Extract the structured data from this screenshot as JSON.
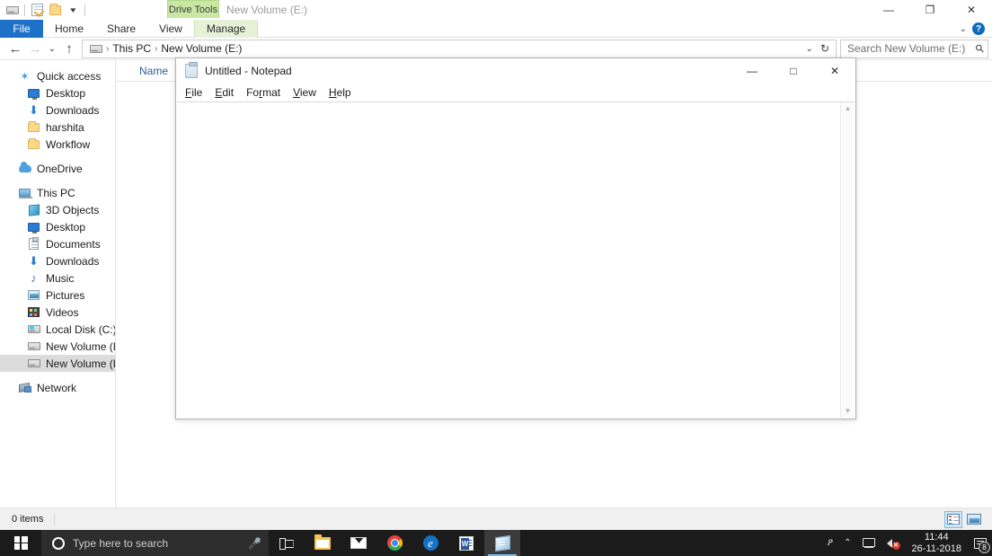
{
  "explorer": {
    "quick_access_toolbar": {
      "drive_icon": "drive-icon",
      "properties_icon": "properties-icon",
      "new_folder_icon": "new-folder-icon",
      "customize_caret": "▾"
    },
    "title": "New Volume (E:)",
    "contextual_tab_group": "Drive Tools",
    "window_buttons": {
      "minimize": "—",
      "restore": "❐",
      "close": "✕"
    },
    "ribbon": {
      "tabs": [
        {
          "label": "File",
          "type": "file"
        },
        {
          "label": "Home",
          "type": "normal"
        },
        {
          "label": "Share",
          "type": "normal"
        },
        {
          "label": "View",
          "type": "normal"
        },
        {
          "label": "Manage",
          "type": "contextual"
        }
      ],
      "collapse_caret": "⌄",
      "help_label": "?"
    },
    "address_bar": {
      "back": "←",
      "forward": "→",
      "recent": "⌄",
      "up": "↑",
      "crumbs": [
        "This PC",
        "New Volume (E:)"
      ],
      "crumb_separator": "›",
      "history_caret": "⌄",
      "refresh": "↻"
    },
    "search": {
      "placeholder": "Search New Volume (E:)",
      "icon": "search-icon"
    },
    "nav_pane": {
      "groups": [
        {
          "header": {
            "label": "Quick access",
            "icon": "pin-star-icon"
          },
          "items": [
            {
              "label": "Desktop",
              "icon": "desktop-icon"
            },
            {
              "label": "Downloads",
              "icon": "download-icon"
            },
            {
              "label": "harshita",
              "icon": "folder-icon"
            },
            {
              "label": "Workflow",
              "icon": "folder-icon"
            }
          ]
        },
        {
          "header": {
            "label": "OneDrive",
            "icon": "cloud-icon"
          },
          "items": []
        },
        {
          "header": {
            "label": "This PC",
            "icon": "this-pc-icon"
          },
          "items": [
            {
              "label": "3D Objects",
              "icon": "3d-objects-icon"
            },
            {
              "label": "Desktop",
              "icon": "desktop-icon"
            },
            {
              "label": "Documents",
              "icon": "documents-icon"
            },
            {
              "label": "Downloads",
              "icon": "download-icon"
            },
            {
              "label": "Music",
              "icon": "music-icon"
            },
            {
              "label": "Pictures",
              "icon": "pictures-icon"
            },
            {
              "label": "Videos",
              "icon": "videos-icon"
            },
            {
              "label": "Local Disk (C:)",
              "icon": "windows-drive-icon"
            },
            {
              "label": "New Volume (D:)",
              "icon": "drive-icon"
            },
            {
              "label": "New Volume (E:)",
              "icon": "drive-icon",
              "selected": true
            }
          ]
        },
        {
          "header": {
            "label": "Network",
            "icon": "network-icon"
          },
          "items": []
        }
      ]
    },
    "file_list": {
      "columns": [
        "Name"
      ],
      "rows": []
    },
    "status_bar": {
      "item_count": "0 items",
      "view_buttons": [
        {
          "name": "details-view",
          "active": true
        },
        {
          "name": "large-icons-view",
          "active": false
        }
      ]
    }
  },
  "notepad": {
    "title": "Untitled - Notepad",
    "icon": "notepad-icon",
    "window_buttons": {
      "minimize": "—",
      "maximize": "□",
      "close": "✕"
    },
    "menu": [
      {
        "accel": "F",
        "rest": "ile"
      },
      {
        "accel": "E",
        "rest": "dit"
      },
      {
        "pre": "Fo",
        "accel": "r",
        "rest": "mat"
      },
      {
        "accel": "V",
        "rest": "iew"
      },
      {
        "accel": "H",
        "rest": "elp"
      }
    ],
    "text_content": "",
    "scrollbar": {
      "up": "▲",
      "down": "▼"
    }
  },
  "taskbar": {
    "start_button": "start-button",
    "search": {
      "placeholder": "Type here to search",
      "cortana_icon": "cortana-circle-icon",
      "mic_icon": "microphone-icon"
    },
    "pinned": [
      {
        "name": "task-view-button",
        "icon": "task-view-icon",
        "active": false
      },
      {
        "name": "file-explorer-button",
        "icon": "file-explorer-icon",
        "active": false
      },
      {
        "name": "mail-button",
        "icon": "mail-icon",
        "active": false
      },
      {
        "name": "chrome-button",
        "icon": "chrome-icon",
        "active": false
      },
      {
        "name": "edge-button",
        "icon": "edge-icon",
        "active": false
      },
      {
        "name": "word-button",
        "icon": "word-icon",
        "active": false
      },
      {
        "name": "notepad-button",
        "icon": "notepad-icon",
        "active": true
      }
    ],
    "tray": {
      "people_icon": "people-icon",
      "show_hidden_caret": "⌃",
      "network_icon": "network-icon",
      "volume_icon": "volume-muted-icon",
      "volume_badge": "✕",
      "time": "11:44",
      "date": "26-11-2018",
      "action_center_icon": "action-center-icon",
      "notification_count": "8"
    }
  }
}
